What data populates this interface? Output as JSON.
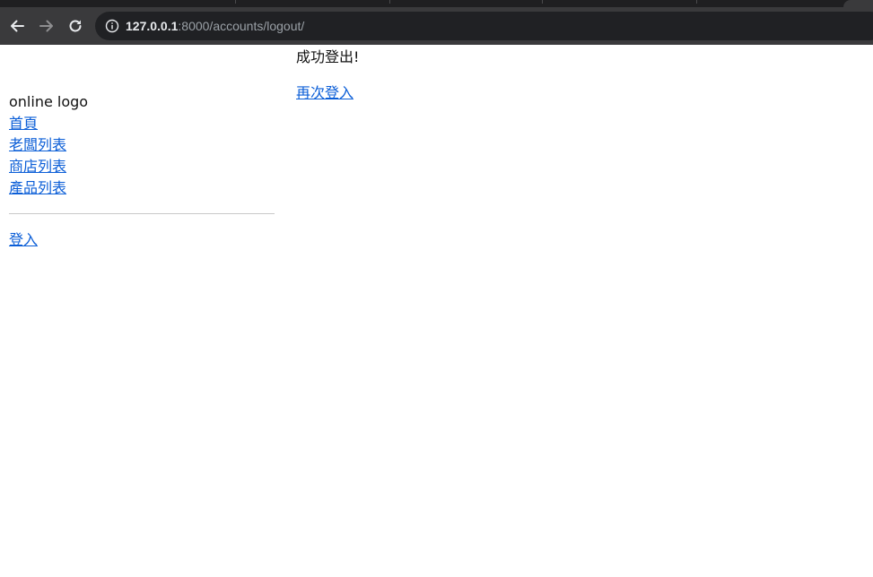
{
  "browser": {
    "url_host": "127.0.0.1",
    "url_path": ":8000/accounts/logout/",
    "back_icon": "arrow-left-icon",
    "forward_icon": "arrow-right-icon",
    "reload_icon": "reload-icon",
    "info_icon": "info-icon"
  },
  "sidebar": {
    "logo": "online logo",
    "links": [
      {
        "label": "首頁"
      },
      {
        "label": "老闆列表"
      },
      {
        "label": "商店列表"
      },
      {
        "label": "產品列表"
      }
    ],
    "login_label": "登入"
  },
  "main": {
    "message": "成功登出!",
    "relogin_label": "再次登入"
  },
  "colors": {
    "link": "#0b5ed7",
    "chrome": "#3a3a3c",
    "address_bar": "#202124"
  }
}
